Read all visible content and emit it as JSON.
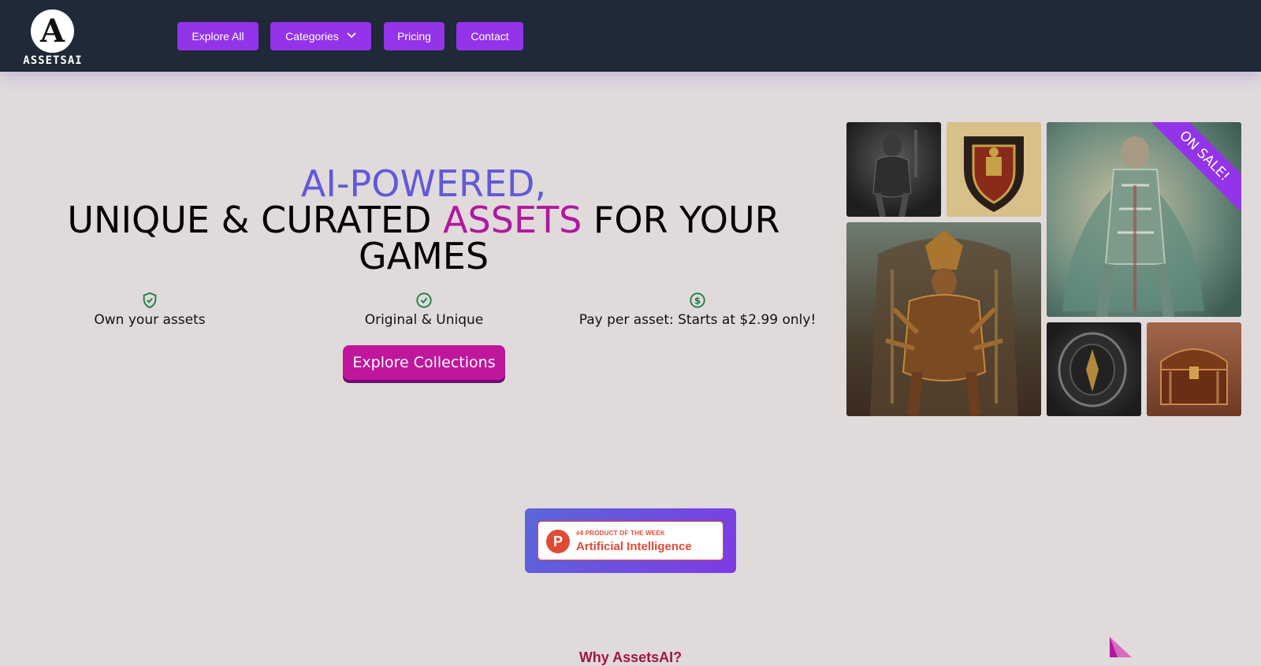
{
  "brand": {
    "logo_letter": "A",
    "name": "ASSETSAI"
  },
  "nav": {
    "explore_all": "Explore All",
    "categories": "Categories",
    "pricing": "Pricing",
    "contact": "Contact"
  },
  "hero": {
    "line1": "AI-POWERED,",
    "line2_prefix": "UNIQUE & CURATED ",
    "line2_accent": "ASSETS",
    "line2_suffix": " FOR YOUR",
    "line3": "GAMES"
  },
  "features": [
    {
      "icon": "shield-check-icon",
      "label": "Own your assets"
    },
    {
      "icon": "badge-check-icon",
      "label": "Original & Unique"
    },
    {
      "icon": "dollar-circle-icon",
      "label": "Pay per asset: Starts at $2.99 only!"
    }
  ],
  "cta": {
    "label": "Explore Collections"
  },
  "gallery": {
    "ribbon": "ON SALE!",
    "tiles": [
      {
        "name": "armored-knight-image"
      },
      {
        "name": "heraldic-shield-image"
      },
      {
        "name": "jade-warrior-image"
      },
      {
        "name": "golden-throne-deity-image"
      },
      {
        "name": "dark-shield-image"
      },
      {
        "name": "treasure-chest-image"
      }
    ]
  },
  "producthunt": {
    "logo": "P",
    "rank": "#4 PRODUCT OF THE WEEK",
    "category": "Artificial Intelligence"
  },
  "why": {
    "title": "Why AssetsAI?"
  },
  "colors": {
    "nav_bg": "#1f2937",
    "button": "#9333ea",
    "accent_pink": "#b0189e",
    "accent_blue": "#6259d8",
    "feature_icon": "#15803d",
    "cta": "#c0169c",
    "producthunt": "#e04b36"
  }
}
